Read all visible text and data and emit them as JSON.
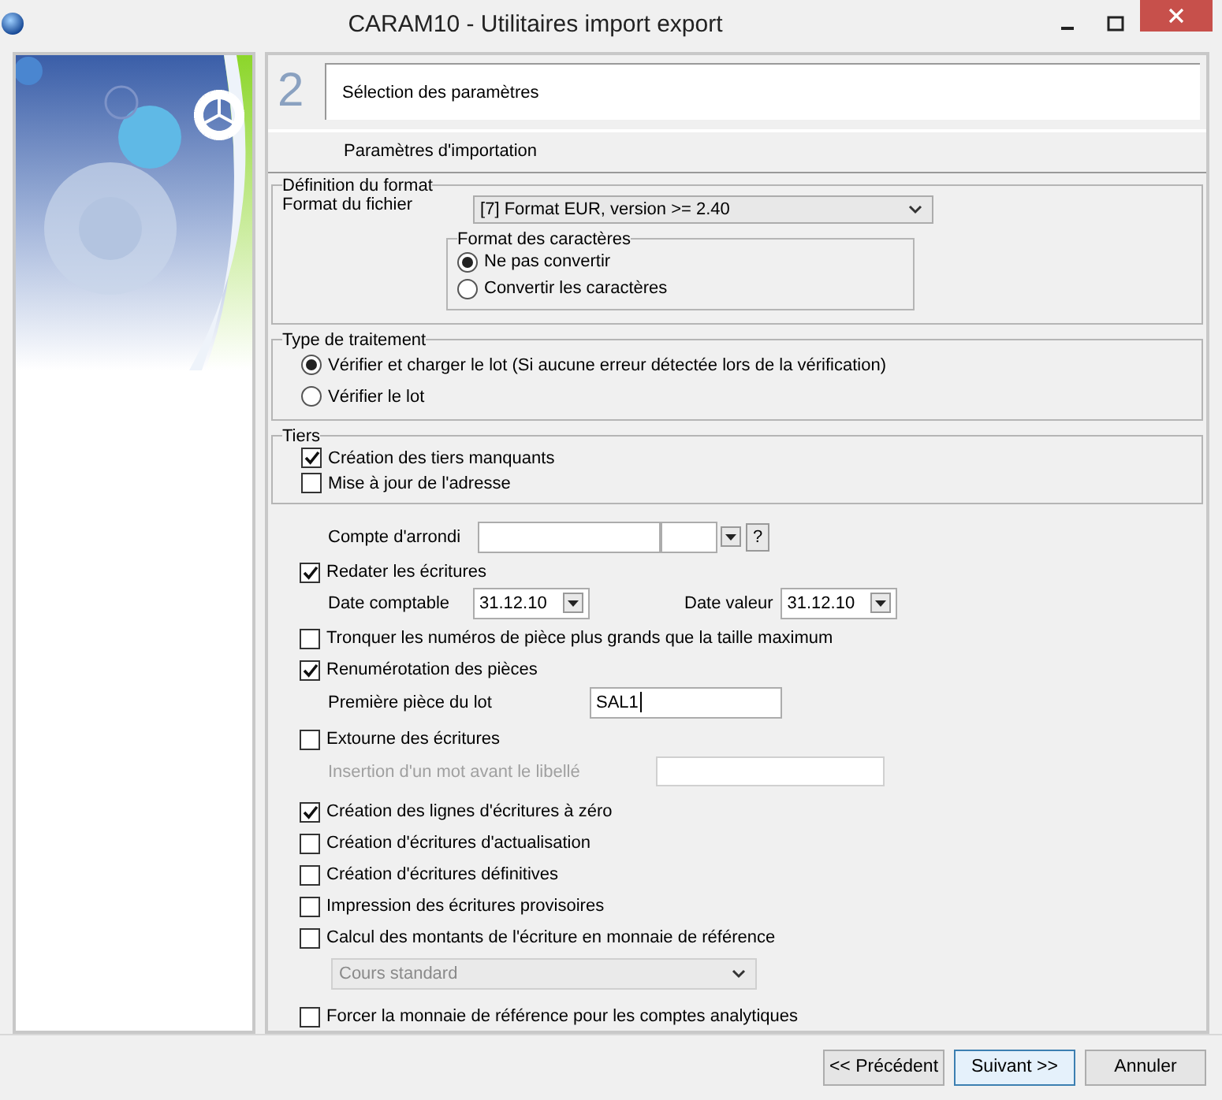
{
  "window": {
    "title": "CARAM10 - Utilitaires import export"
  },
  "step": {
    "number": "2",
    "title": "Sélection des paramètres"
  },
  "section_header": "Paramètres d'importation",
  "format_group": {
    "title": "Définition du format",
    "file_format_label": "Format du fichier",
    "file_format_value": "[7] Format EUR, version >= 2.40",
    "charset_group": {
      "title": "Format des caractères",
      "options": [
        {
          "label": "Ne pas convertir",
          "selected": true
        },
        {
          "label": "Convertir les caractères",
          "selected": false
        }
      ]
    }
  },
  "processing_group": {
    "title": "Type de traitement",
    "options": [
      {
        "label": "Vérifier et charger le lot (Si aucune erreur détectée lors de la vérification)",
        "selected": true
      },
      {
        "label": "Vérifier le lot",
        "selected": false
      }
    ]
  },
  "tiers_group": {
    "title": "Tiers",
    "options": [
      {
        "label": "Création des tiers manquants",
        "checked": true
      },
      {
        "label": "Mise à jour de l'adresse",
        "checked": false
      }
    ]
  },
  "rounding": {
    "label": "Compte d'arrondi",
    "help": "?"
  },
  "options": [
    {
      "kind": "checkbox",
      "label": "Redater les écritures",
      "checked": true
    },
    {
      "kind": "dates",
      "fields": [
        {
          "label": "Date comptable",
          "value": "31.12.10"
        },
        {
          "label": "Date valeur",
          "value": "31.12.10"
        }
      ]
    },
    {
      "kind": "checkbox",
      "label": "Tronquer les numéros de pièce plus grands que la taille maximum",
      "checked": false
    },
    {
      "kind": "checkbox",
      "label": "Renumérotation des pièces",
      "checked": true
    },
    {
      "kind": "text",
      "label": "Première pièce du lot",
      "value": "SAL1",
      "disabled": false
    },
    {
      "kind": "checkbox",
      "label": "Extourne des écritures",
      "checked": false
    },
    {
      "kind": "text",
      "label": "Insertion d'un mot avant le libellé",
      "disabled": true
    },
    {
      "kind": "checkbox",
      "label": "Création des lignes d'écritures à zéro",
      "checked": true
    },
    {
      "kind": "checkbox",
      "label": "Création d'écritures d'actualisation",
      "checked": false
    },
    {
      "kind": "checkbox",
      "label": "Création d'écritures définitives",
      "checked": false
    },
    {
      "kind": "checkbox",
      "label": "Impression des écritures provisoires",
      "checked": false
    },
    {
      "kind": "checkbox",
      "label": "Calcul des montants de l'écriture en monnaie de référence",
      "checked": false
    },
    {
      "kind": "select",
      "value": "Cours standard",
      "disabled": true
    },
    {
      "kind": "checkbox",
      "label": "Forcer la monnaie de référence pour les comptes analytiques",
      "checked": false
    }
  ],
  "buttons": [
    {
      "label": "<< Précédent",
      "focused": false
    },
    {
      "label": "Suivant >>",
      "focused": true
    },
    {
      "label": "Annuler",
      "focused": false
    }
  ]
}
